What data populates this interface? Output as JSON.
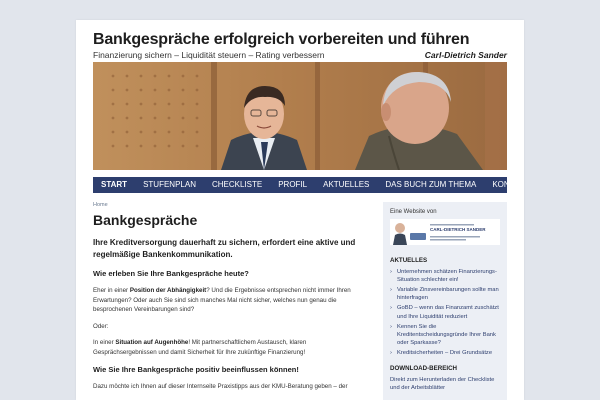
{
  "header": {
    "title": "Bankgespräche erfolgreich vorbereiten und führen",
    "tagline": "Finanzierung sichern – Liquidität steuern – Rating verbessern",
    "author": "Carl-Dietrich Sander"
  },
  "nav": {
    "items": [
      "Start",
      "Stufenplan",
      "Checkliste",
      "Profil",
      "Aktuelles",
      "Das Buch zum Thema",
      "Kontakt"
    ],
    "active_index": 0
  },
  "content": {
    "breadcrumb": "Home",
    "title": "Bankgespräche",
    "lead": "Ihre Kreditversorgung dauerhaft zu sichern, erfordert eine aktive und regelmäßige Bankenkommunikation.",
    "h1": "Wie erleben Sie Ihre Bankgespräche heute?",
    "p1_pre": "Eher in einer ",
    "p1_bold": "Position der Abhängigkeit",
    "p1_post": "? Und die Ergebnisse entsprechen nicht immer Ihren Erwartungen? Oder auch Sie sind sich manches Mal nicht sicher, welches nun genau die besprochenen Vereinbarungen sind?",
    "p2": "Oder:",
    "p3_pre": "In einer ",
    "p3_bold": "Situation auf Augenhöhe",
    "p3_post": "! Mit partnerschaftlichem Austausch, klaren Gesprächsergebnissen und damit Sicherheit für Ihre zukünftige Finanzierung!",
    "h2": "Wie Sie Ihre Bankgespräche positiv beeinflussen können!",
    "p4": "Dazu möchte ich Ihnen auf dieser Internseite Praxistipps aus der KMU-Beratung geben – der"
  },
  "sidebar": {
    "website_label": "Eine Website von",
    "ad_name": "CARL-DIETRICH SANDER",
    "aktuelles_heading": "Aktuelles",
    "aktuelles": [
      "Unternehmen schätzen Finanzierungs-Situation schlechter ein!",
      "Variable Zinsvereinbarungen sollte man hinterfragen",
      "GoBD – wenn das Finanzamt zuschätzt und Ihre Liquidität reduziert",
      "Kennen Sie die Kreditentscheidungsgründe Ihrer Bank oder Sparkasse?",
      "Kreditsicherheiten – Drei Grundsätze"
    ],
    "download_heading": "Download-Bereich",
    "download_text": "Direkt zum Herunterladen der Checkliste und der Arbeitsblätter"
  },
  "colors": {
    "accent": "#2d3e6e",
    "sidebar_bg": "#eceff5",
    "page_bg": "#e1e5ec"
  }
}
